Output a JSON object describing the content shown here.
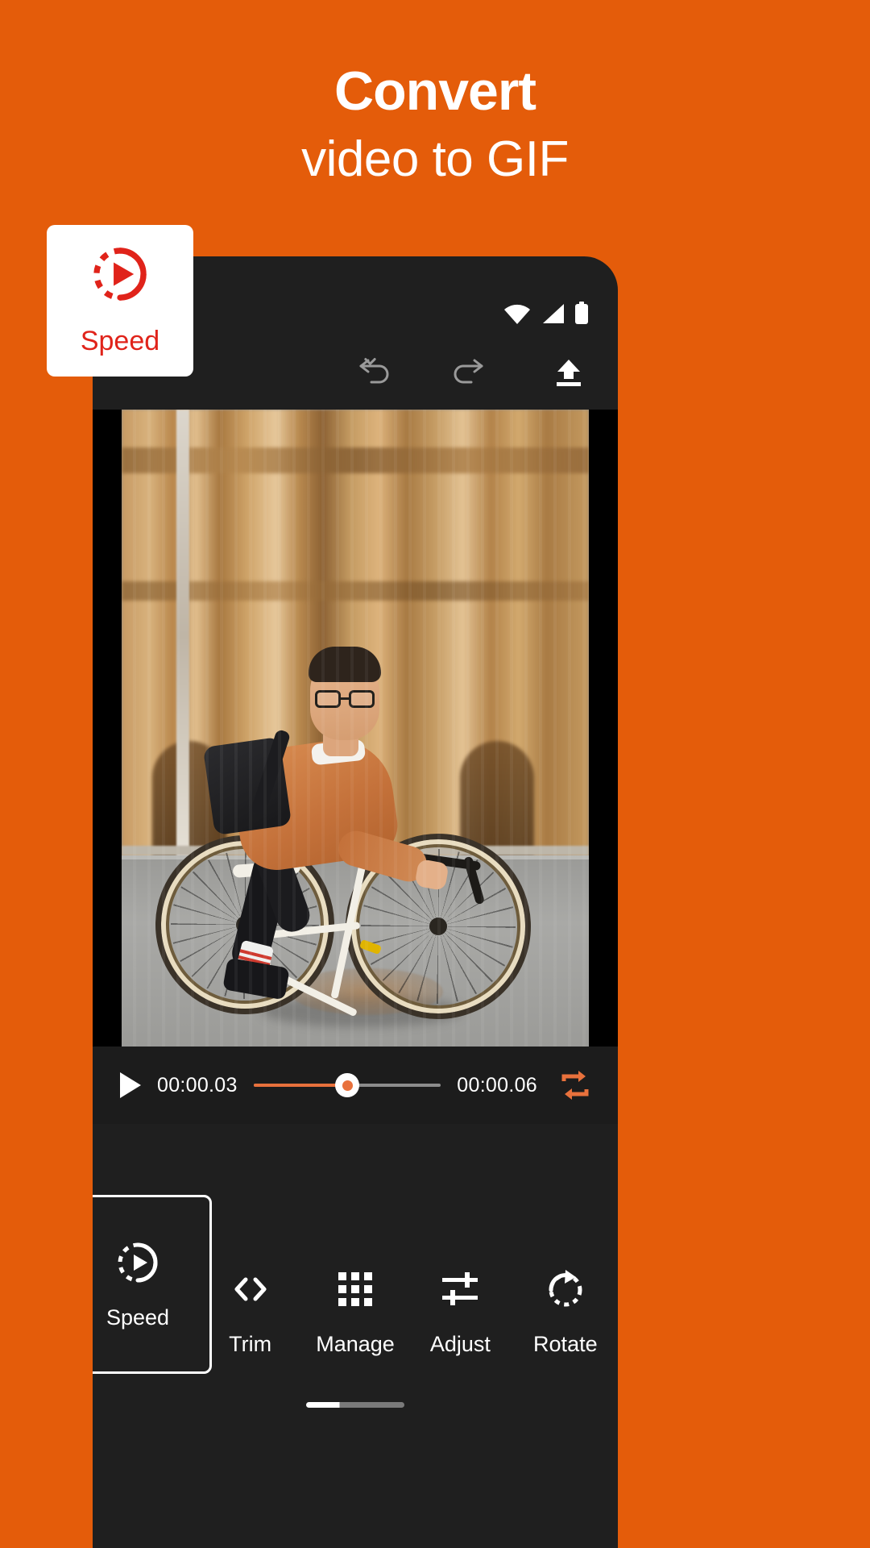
{
  "promo": {
    "title_line1": "Convert",
    "title_line2": "video to GIF",
    "background_color": "#E45C0A",
    "text_color": "#FFFFFF"
  },
  "speed_card": {
    "label": "Speed",
    "icon": "speed-play-icon",
    "icon_color": "#E0231A",
    "card_color": "#FFFFFF"
  },
  "phone": {
    "frame_color": "#1F1F1F",
    "status_bar": {
      "icons": [
        "wifi-icon",
        "cellular-signal-icon",
        "battery-icon"
      ]
    },
    "top_toolbar": {
      "buttons": [
        {
          "name": "undo-button",
          "icon": "undo-arrow-icon",
          "enabled": false
        },
        {
          "name": "redo-button",
          "icon": "redo-arrow-icon",
          "enabled": false
        },
        {
          "name": "export-button",
          "icon": "upload-icon",
          "enabled": true
        }
      ]
    },
    "player": {
      "play_button": "play-icon",
      "current_time": "00:00.03",
      "total_time": "00:00.06",
      "progress_percent": 50,
      "progress_fill_color": "#E8713C",
      "progress_track_color": "#8C8C8C",
      "loop_button": {
        "icon": "loop-icon",
        "color": "#E8713C",
        "active": true
      }
    },
    "bottom_toolbar": {
      "items": [
        {
          "label": "Speed",
          "icon": "speed-play-icon",
          "selected": true
        },
        {
          "label": "Trim",
          "icon": "code-brackets-icon",
          "selected": false
        },
        {
          "label": "Manage",
          "icon": "grid-icon",
          "selected": false
        },
        {
          "label": "Adjust",
          "icon": "sliders-icon",
          "selected": false
        },
        {
          "label": "Rotate",
          "icon": "rotate-icon",
          "selected": false
        }
      ]
    },
    "home_indicator": "home-indicator"
  }
}
